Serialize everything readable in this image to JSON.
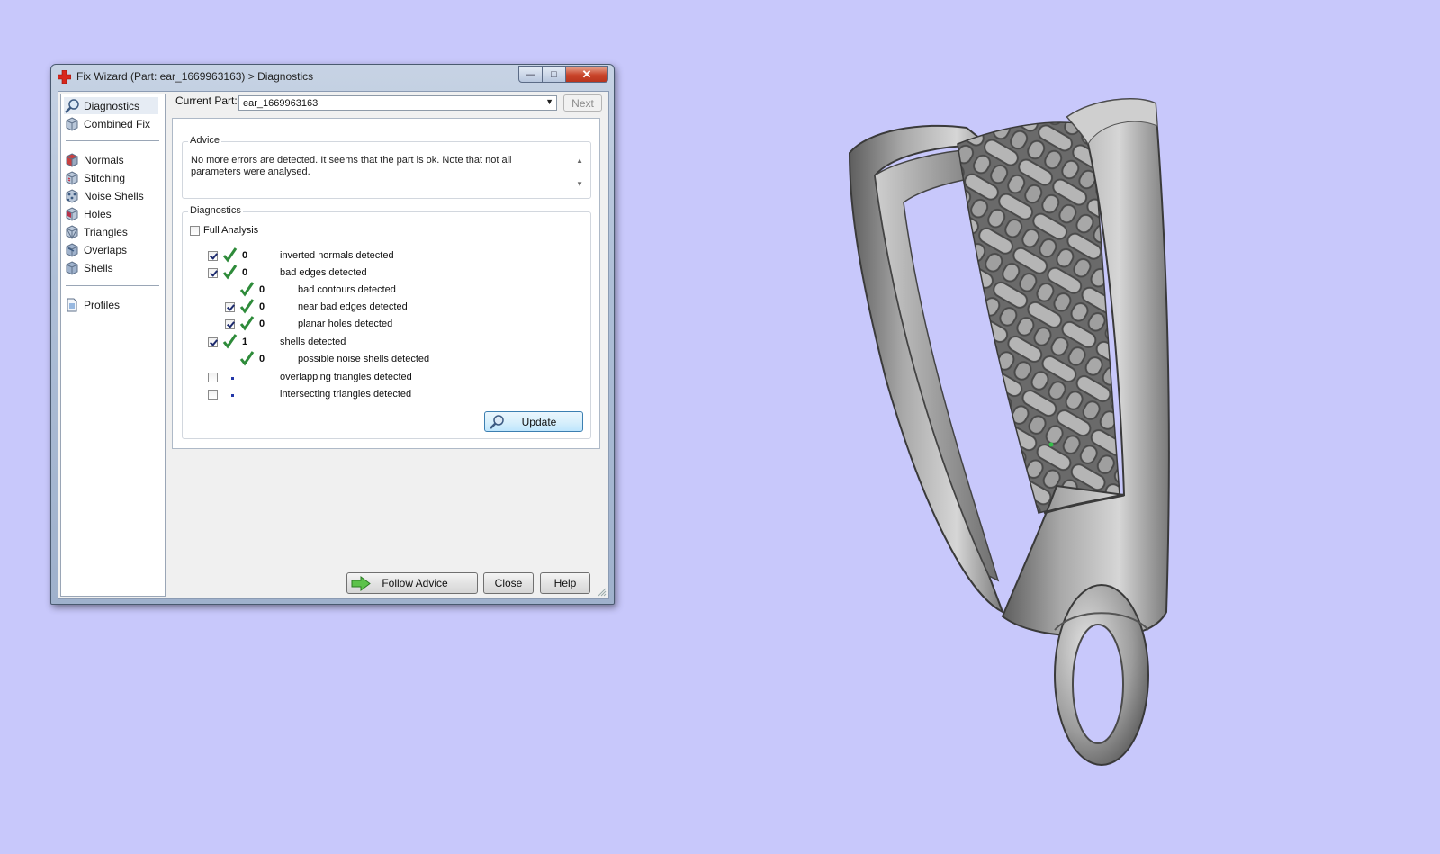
{
  "window": {
    "title": "Fix Wizard (Part: ear_1669963163) > Diagnostics",
    "controls": [
      "minimize",
      "maximize",
      "close"
    ]
  },
  "sidebar": {
    "items": [
      {
        "label": "Diagnostics",
        "icon": "magnifier-icon",
        "active": true
      },
      {
        "label": "Combined Fix",
        "icon": "cube-icon"
      },
      {
        "label": "Normals",
        "icon": "normals-cube-icon"
      },
      {
        "label": "Stitching",
        "icon": "stitching-cube-icon"
      },
      {
        "label": "Noise Shells",
        "icon": "noise-shells-icon"
      },
      {
        "label": "Holes",
        "icon": "holes-cube-icon"
      },
      {
        "label": "Triangles",
        "icon": "triangles-cube-icon"
      },
      {
        "label": "Overlaps",
        "icon": "overlaps-cube-icon"
      },
      {
        "label": "Shells",
        "icon": "shells-cube-icon"
      },
      {
        "label": "Profiles",
        "icon": "document-icon"
      }
    ]
  },
  "current_part": {
    "label": "Current Part:",
    "value": "ear_1669963163",
    "next_label": "Next"
  },
  "advice": {
    "title": "Advice",
    "text": "No more errors are detected. It seems that the part is ok. Note that not all parameters were analysed."
  },
  "diagnostics": {
    "title": "Diagnostics",
    "full_analysis_label": "Full Analysis",
    "full_analysis_checked": false,
    "rows": [
      {
        "label": "inverted normals detected",
        "value": "0",
        "checked": true,
        "has_checkbox": true,
        "status": "ok",
        "level": 0
      },
      {
        "label": "bad edges detected",
        "value": "0",
        "checked": true,
        "has_checkbox": true,
        "status": "ok",
        "level": 0
      },
      {
        "label": "bad contours detected",
        "value": "0",
        "checked": false,
        "has_checkbox": false,
        "status": "ok",
        "level": 1
      },
      {
        "label": "near bad edges detected",
        "value": "0",
        "checked": true,
        "has_checkbox": true,
        "status": "ok",
        "level": 1
      },
      {
        "label": "planar holes detected",
        "value": "0",
        "checked": true,
        "has_checkbox": true,
        "status": "ok",
        "level": 1
      },
      {
        "label": "shells detected",
        "value": "1",
        "checked": true,
        "has_checkbox": true,
        "status": "ok",
        "level": 0
      },
      {
        "label": "possible noise shells detected",
        "value": "0",
        "checked": false,
        "has_checkbox": false,
        "status": "ok",
        "level": 1
      },
      {
        "label": "overlapping triangles detected",
        "value": "",
        "checked": false,
        "has_checkbox": true,
        "status": "pending",
        "level": 0
      },
      {
        "label": "intersecting triangles detected",
        "value": "",
        "checked": false,
        "has_checkbox": true,
        "status": "pending",
        "level": 0
      }
    ],
    "update_label": "Update"
  },
  "footer": {
    "follow_advice_label": "Follow Advice",
    "close_label": "Close",
    "help_label": "Help"
  },
  "colors": {
    "desktop_background": "#c8c8fb",
    "check_green": "#2e8b3a",
    "close_button_red": "#c9452b",
    "model_grey": "#8a8a8a"
  }
}
